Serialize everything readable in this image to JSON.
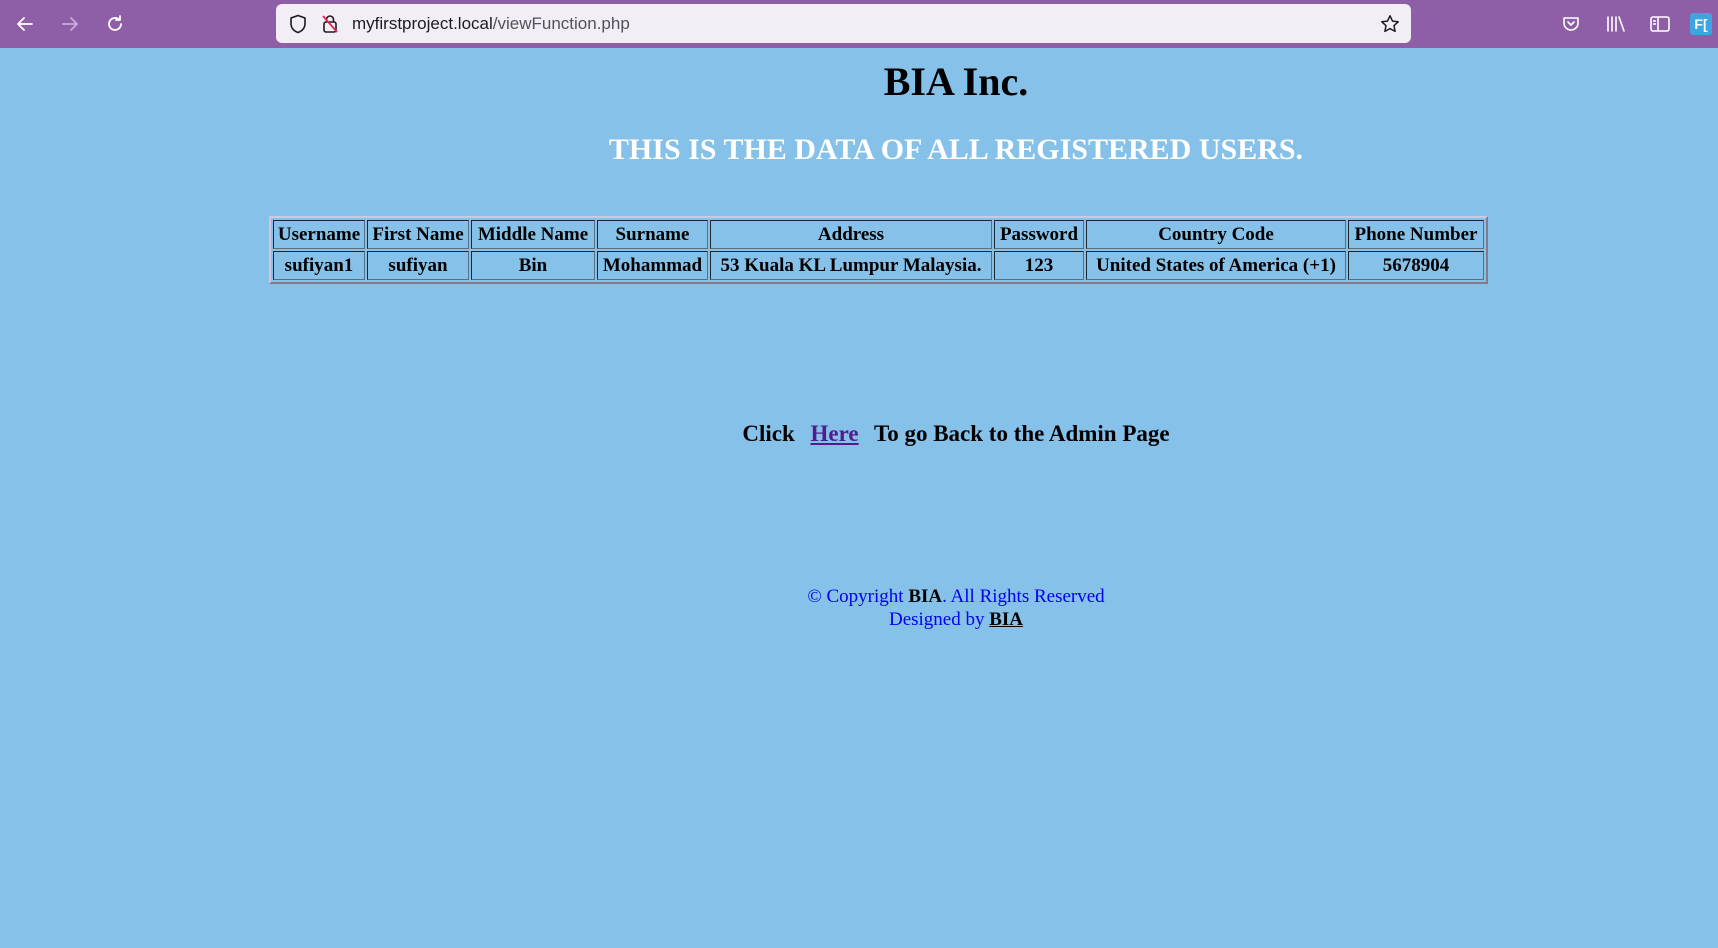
{
  "browser": {
    "url_host": "myfirstproject.local",
    "url_path": "/viewFunction.php",
    "extension_label": "F["
  },
  "page": {
    "title": "BIA Inc.",
    "subtitle": "THIS IS THE DATA OF ALL REGISTERED USERS.",
    "table": {
      "headers": [
        "Username",
        "First Name",
        "Middle Name",
        "Surname",
        "Address",
        "Password",
        "Country Code",
        "Phone Number"
      ],
      "rows": [
        [
          "sufiyan1",
          "sufiyan",
          "Bin",
          "Mohammad",
          "53 Kuala KL Lumpur Malaysia.",
          "123",
          "United States of America (+1)",
          "5678904"
        ]
      ]
    },
    "back": {
      "prefix": "Click",
      "link_label": "Here",
      "suffix": "To go Back to the Admin Page"
    },
    "footer": {
      "copyright_prefix": "© Copyright ",
      "brand": "BIA",
      "copyright_suffix": ". All Rights Reserved",
      "designed_prefix": "Designed by ",
      "designer": "BIA"
    }
  },
  "colors": {
    "page_background": "#85c1e9",
    "toolbar_background": "#8e5ea7",
    "subtitle": "#ffffff",
    "footer_text": "#0000ee",
    "link_visited": "#551a8b"
  }
}
